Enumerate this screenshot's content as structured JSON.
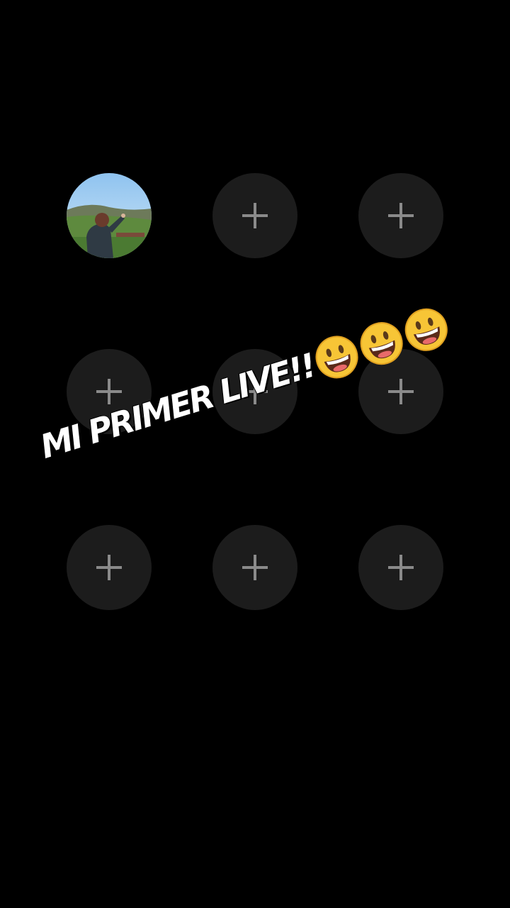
{
  "participants": {
    "host": {
      "name": "host-avatar"
    },
    "empty_slot_icon": "plus-icon",
    "slot_count": 8
  },
  "overlay": {
    "text": "MI PRIMER LIVE!!",
    "emoji_icon": "grinning-face-icon",
    "emoji_count": 3
  },
  "colors": {
    "background": "#000000",
    "slot_fill": "#1c1c1c",
    "plus": "#8a8a8a",
    "text": "#ffffff"
  }
}
